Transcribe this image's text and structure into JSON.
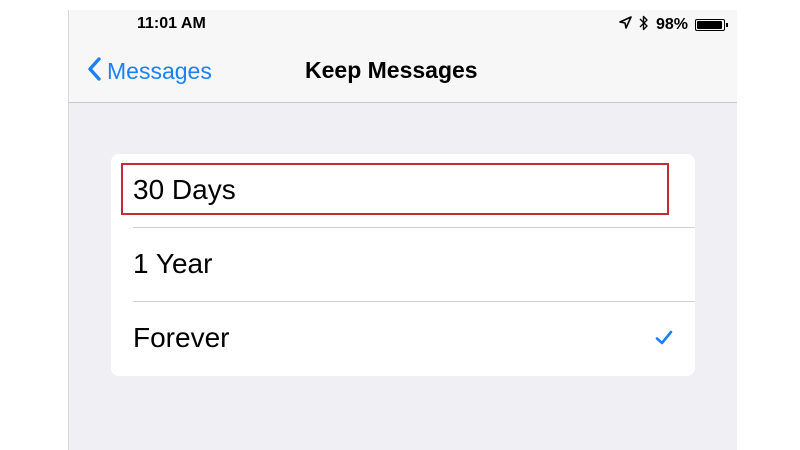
{
  "status_bar": {
    "time": "11:01 AM",
    "battery_percent_label": "98%",
    "battery_level": 0.98,
    "icons": [
      "location-arrow-icon",
      "bluetooth-icon",
      "battery-icon"
    ]
  },
  "nav": {
    "back_label": "Messages",
    "title": "Keep Messages"
  },
  "options": [
    {
      "label": "30 Days",
      "selected": false,
      "highlighted": true
    },
    {
      "label": "1 Year",
      "selected": false,
      "highlighted": false
    },
    {
      "label": "Forever",
      "selected": true,
      "highlighted": false
    }
  ],
  "colors": {
    "accent": "#1a82f6",
    "highlight_border": "#c62a37",
    "background": "#efeff4"
  }
}
